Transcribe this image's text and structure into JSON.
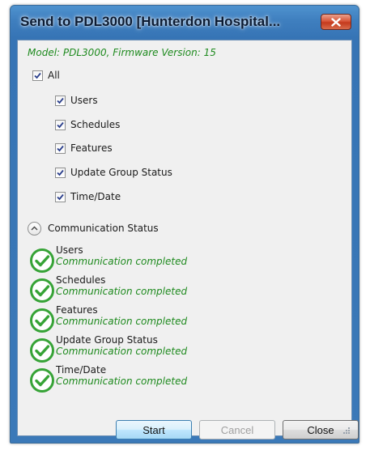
{
  "window": {
    "title": "Send to PDL3000 [Hunterdon Hospital..."
  },
  "model_line": "Model: PDL3000, Firmware Version: 15",
  "select_all": {
    "label": "All",
    "checked": true
  },
  "options": [
    {
      "label": "Users",
      "checked": true
    },
    {
      "label": "Schedules",
      "checked": true
    },
    {
      "label": "Features",
      "checked": true
    },
    {
      "label": "Update Group Status",
      "checked": true
    },
    {
      "label": "Time/Date",
      "checked": true
    }
  ],
  "communication_status": {
    "label": "Communication Status",
    "items": [
      {
        "name": "Users",
        "status": "Communication completed",
        "icon": "check-circle-icon"
      },
      {
        "name": "Schedules",
        "status": "Communication completed",
        "icon": "check-circle-icon"
      },
      {
        "name": "Features",
        "status": "Communication completed",
        "icon": "check-circle-icon"
      },
      {
        "name": "Update Group Status",
        "status": "Communication completed",
        "icon": "check-circle-icon"
      },
      {
        "name": "Time/Date",
        "status": "Communication completed",
        "icon": "check-circle-icon"
      }
    ]
  },
  "buttons": {
    "start": "Start",
    "cancel": "Cancel",
    "close": "Close"
  },
  "colors": {
    "status_green": "#1e8a1e",
    "title_bar": "#3674b5",
    "close_red": "#c43a1d"
  }
}
